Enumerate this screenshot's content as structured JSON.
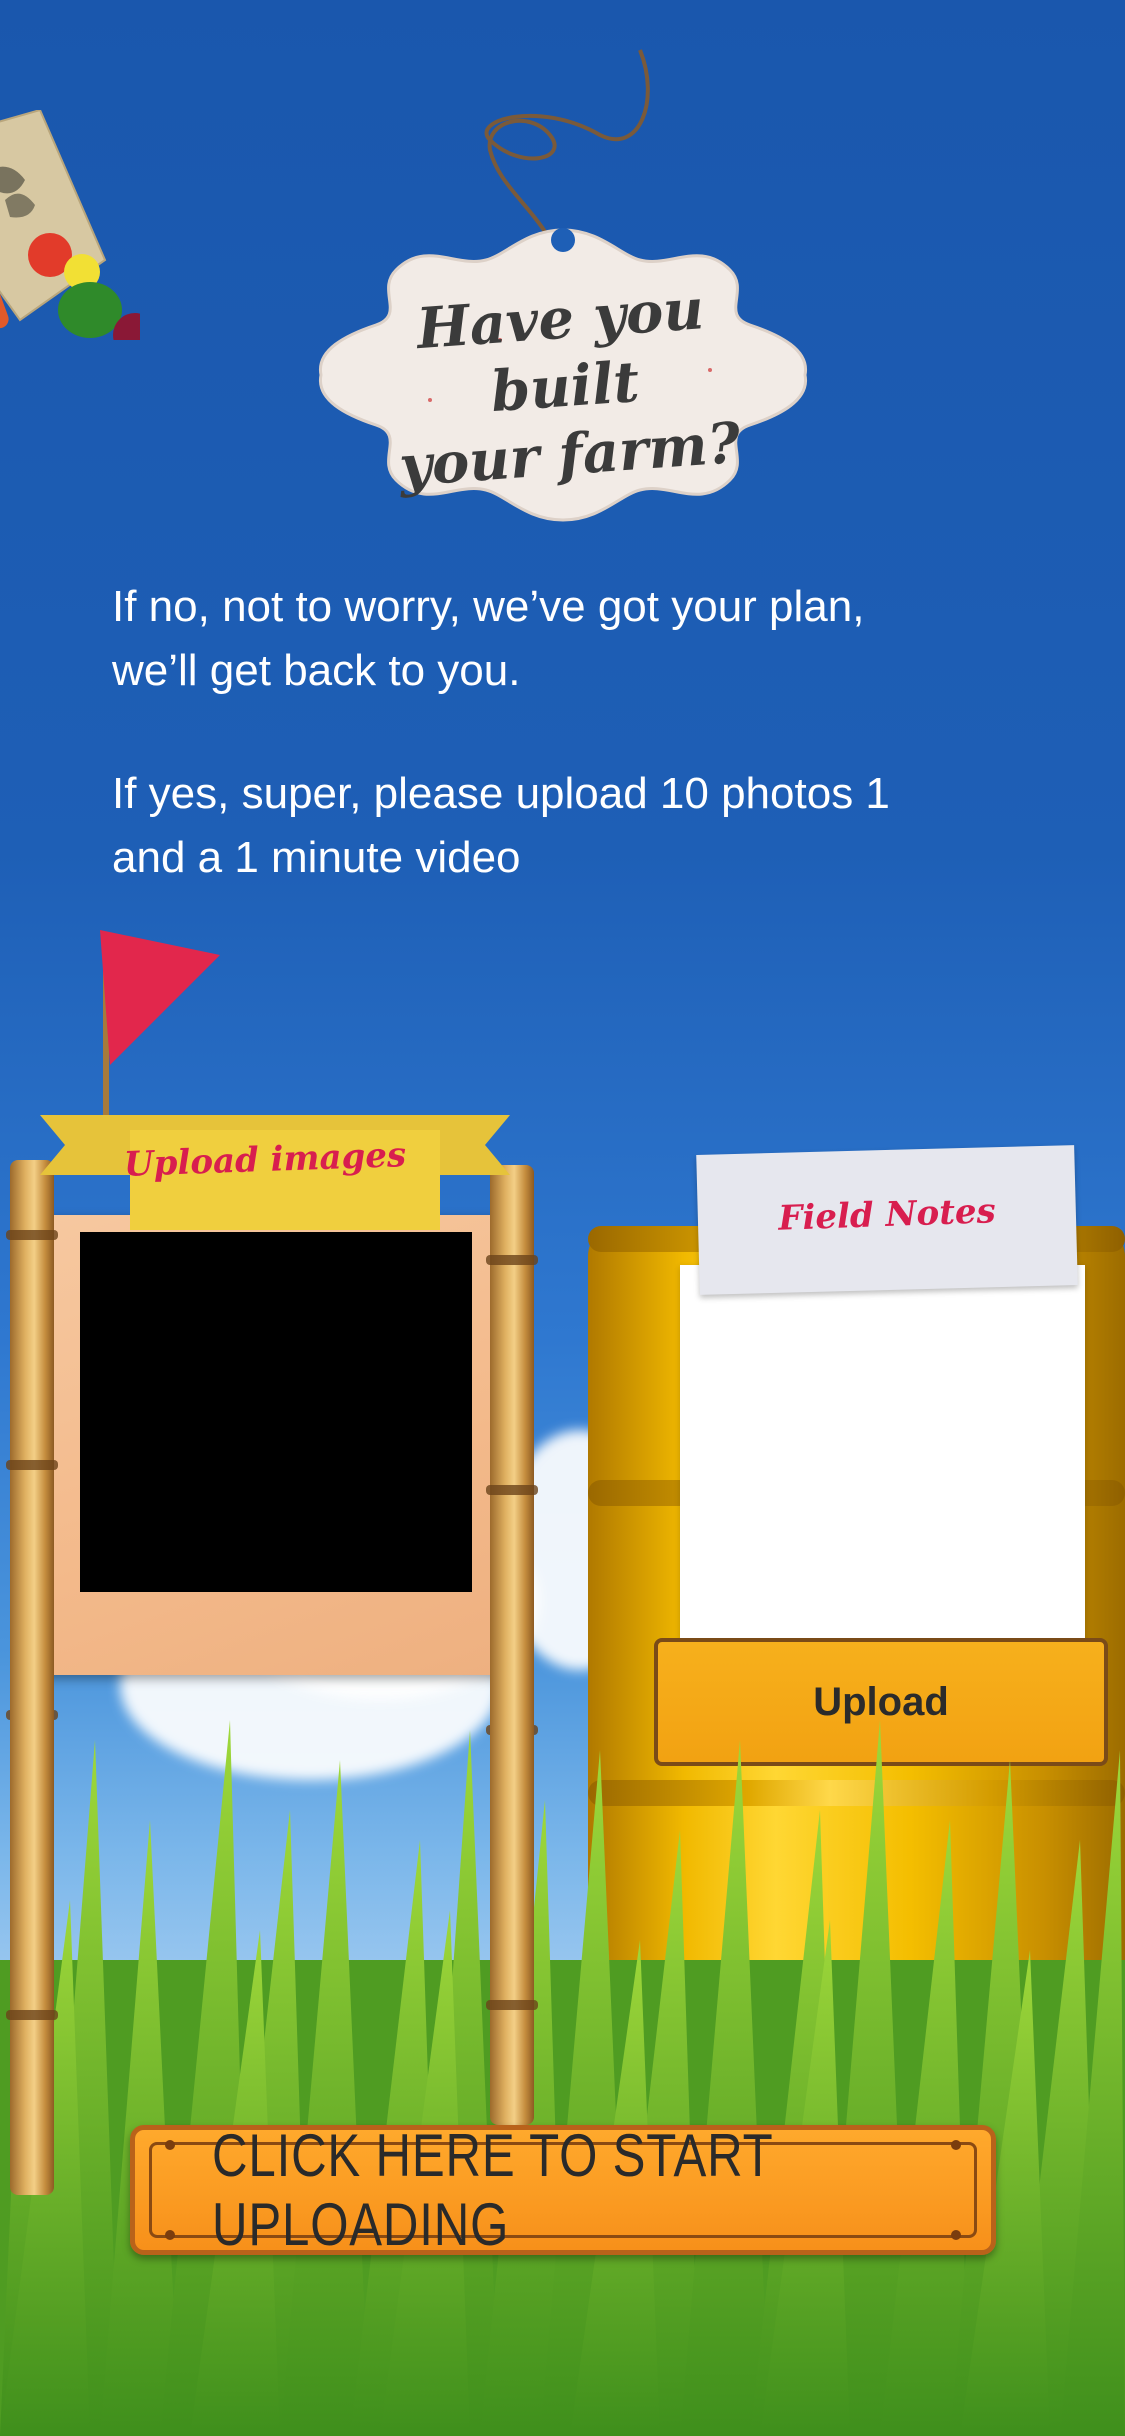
{
  "tag": {
    "title_line1": "Have you built",
    "title_line2": "your farm?"
  },
  "intro": {
    "paragraph1_line1": "If no, not to worry, we’ve got your plan,",
    "paragraph1_line2": "we’ll get back to you.",
    "paragraph2_line1": "If yes, super, please upload 10 photos 1",
    "paragraph2_line2": "and a 1 minute video"
  },
  "image_upload": {
    "banner_label": "Upload images"
  },
  "field_notes": {
    "title": "Field Notes",
    "upload_label": "Upload"
  },
  "cta": {
    "label": "CLICK HERE TO START UPLOADING"
  },
  "colors": {
    "sky": "#1e5fb6",
    "accent_pink": "#d81e4f",
    "button_orange": "#f7a21a",
    "barrel_yellow": "#f4be00"
  }
}
